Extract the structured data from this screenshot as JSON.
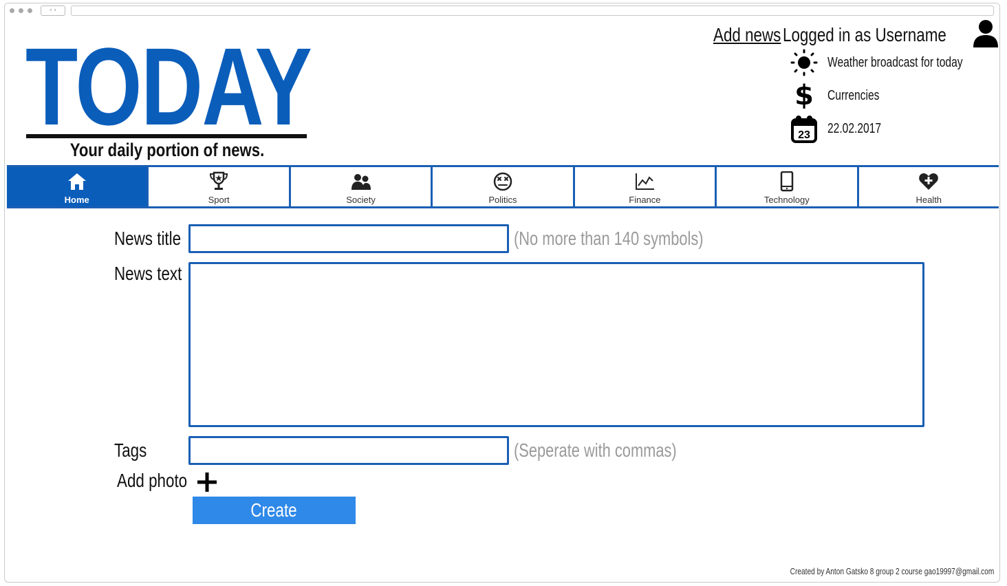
{
  "header": {
    "logo": "TODAY",
    "tagline": "Your daily portion of news.",
    "add_news_link": "Add news",
    "logged_in_text": "Logged in as Username",
    "user_icon": "user-icon"
  },
  "info": {
    "weather": {
      "icon": "sun-icon",
      "text": "Weather broadcast for today"
    },
    "currencies": {
      "icon": "dollar-icon",
      "text": "Currencies"
    },
    "date": {
      "icon": "calendar-icon",
      "icon_number": "23",
      "text": "22.02.2017"
    }
  },
  "nav": {
    "items": [
      {
        "label": "Home",
        "icon": "home-icon",
        "active": true
      },
      {
        "label": "Sport",
        "icon": "trophy-icon"
      },
      {
        "label": "Society",
        "icon": "people-icon"
      },
      {
        "label": "Politics",
        "icon": "face-icon"
      },
      {
        "label": "Finance",
        "icon": "chart-line-icon"
      },
      {
        "label": "Technology",
        "icon": "tablet-icon"
      },
      {
        "label": "Health",
        "icon": "heart-plus-icon"
      }
    ]
  },
  "form": {
    "title_label": "News title",
    "title_value": "",
    "title_hint": "(No more than 140 symbols)",
    "text_label": "News text",
    "text_value": "",
    "tags_label": "Tags",
    "tags_value": "",
    "tags_hint": "(Seperate with commas)",
    "photo_label": "Add photo",
    "photo_icon": "plus-icon",
    "create_button": "Create"
  },
  "footer": {
    "credit": "Created by Anton Gatsko 8 group 2 course gao19997@gmail.com"
  },
  "colors": {
    "brand_blue": "#0b5dba",
    "border_blue": "#1a5fb4",
    "button_blue": "#2f89e8",
    "hint_gray": "#9a9a9a"
  }
}
